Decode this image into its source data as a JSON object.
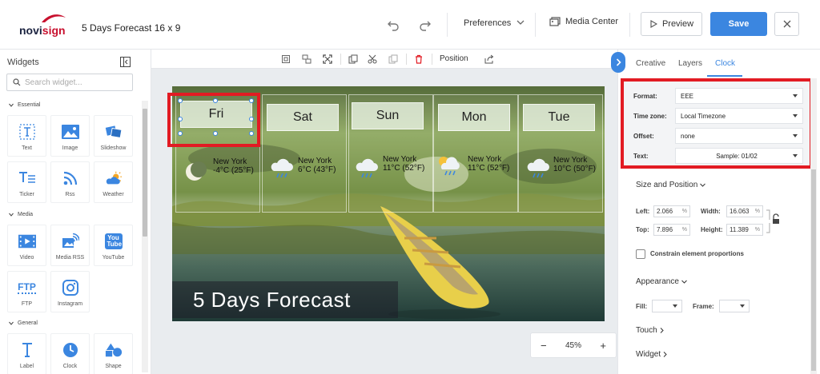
{
  "header": {
    "logo_text_a": "novi",
    "logo_text_b": "sign",
    "doc_title": "5 Days Forecast 16 x 9",
    "preferences_label": "Preferences",
    "media_center_label": "Media Center",
    "preview_label": "Preview",
    "save_label": "Save"
  },
  "widgets": {
    "title": "Widgets",
    "search_placeholder": "Search widget...",
    "sections": {
      "essential": "Essential",
      "media": "Media",
      "general": "General"
    },
    "tiles": {
      "text": "Text",
      "image": "Image",
      "slideshow": "Slideshow",
      "ticker": "Ticker",
      "rss": "Rss",
      "weather": "Weather",
      "video": "Video",
      "media_rss": "Media RSS",
      "youtube": "YouTube",
      "ftp": "FTP",
      "instagram": "Instagram",
      "label": "Label",
      "clock": "Clock",
      "shape": "Shape"
    },
    "ftp_icon_text": "FTP",
    "youtube_icon_text": "You Tube"
  },
  "toolbar": {
    "position_label": "Position"
  },
  "stage": {
    "days": [
      "Fri",
      "Sat",
      "Sun",
      "Mon",
      "Tue"
    ],
    "cities": [
      "New York",
      "New York",
      "New York",
      "New York",
      "New York"
    ],
    "temps": [
      "-4°C (25°F)",
      "6°C (43°F)",
      "11°C (52°F)",
      "11°C (52°F)",
      "10°C (50°F)"
    ],
    "weather_icons": [
      "moon-icon",
      "rain-cloud-icon",
      "rain-cloud-icon",
      "sun-cloud-rain-icon",
      "rain-cloud-icon"
    ],
    "title": "5 Days Forecast"
  },
  "zoom": {
    "minus": "−",
    "value": "45%",
    "plus": "+"
  },
  "right_panel": {
    "tabs": {
      "creative": "Creative",
      "layers": "Layers",
      "clock": "Clock"
    },
    "format_label": "Format:",
    "format_value": "EEE",
    "timezone_label": "Time zone:",
    "timezone_value": "Local Timezone",
    "offset_label": "Offset:",
    "offset_value": "none",
    "text_label": "Text:",
    "text_value": "Sample: 01/02",
    "size_position": "Size and Position",
    "left_label": "Left:",
    "left_value": "2.066",
    "width_label": "Width:",
    "width_value": "16.063",
    "top_label": "Top:",
    "top_value": "7.896",
    "height_label": "Height:",
    "height_value": "11.389",
    "percent": "%",
    "constrain_label": "Constrain element proportions",
    "appearance": "Appearance",
    "fill_label": "Fill:",
    "frame_label": "Frame:",
    "touch": "Touch",
    "widget": "Widget"
  },
  "colors": {
    "accent": "#3b86e0",
    "highlight": "#e21b23",
    "brand_red": "#c8102e",
    "brand_navy": "#1b2340"
  }
}
